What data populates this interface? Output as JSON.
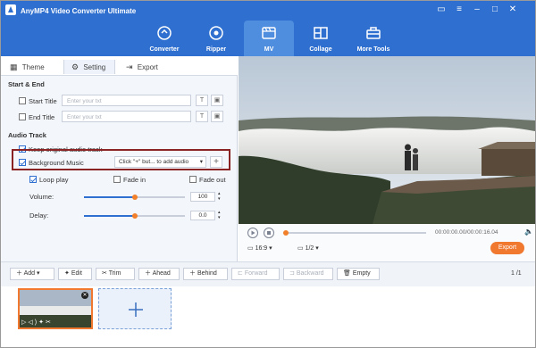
{
  "app": {
    "title": "AnyMP4 Video Converter Ultimate"
  },
  "nav": {
    "tabs": [
      {
        "label": "Converter",
        "icon": "converter-icon"
      },
      {
        "label": "Ripper",
        "icon": "ripper-icon"
      },
      {
        "label": "MV",
        "icon": "mv-icon"
      },
      {
        "label": "Collage",
        "icon": "collage-icon"
      },
      {
        "label": "More Tools",
        "icon": "toolbox-icon"
      }
    ]
  },
  "subtabs": [
    "Theme",
    "Setting",
    "Export"
  ],
  "start_end": {
    "heading": "Start & End",
    "start_title_label": "Start Title",
    "end_title_label": "End Title",
    "placeholder": "Enter your txt"
  },
  "audio": {
    "heading": "Audio Track",
    "keep_original": "Keep original audio track",
    "background_music": "Background Music",
    "bgm_select": "Click \"+\" but... to add audio",
    "loop_play": "Loop play",
    "fade_in": "Fade in",
    "fade_out": "Fade out",
    "volume_label": "Volume:",
    "volume_value": "100",
    "delay_label": "Delay:",
    "delay_value": "0.0"
  },
  "player": {
    "time": "00:00:00.00/00:00:16.04",
    "aspect": "16:9",
    "page": "1/2",
    "export_label": "Export"
  },
  "toolbar": {
    "add": "Add",
    "edit": "Edit",
    "trim": "Trim",
    "ahead": "Ahead",
    "behind": "Behind",
    "forward": "Forward",
    "backward": "Backward",
    "empty": "Empty",
    "page": "1 /1"
  },
  "colors": {
    "header": "#2f6fcf",
    "accent": "#f0782f",
    "highlight_box": "#8a2323"
  }
}
